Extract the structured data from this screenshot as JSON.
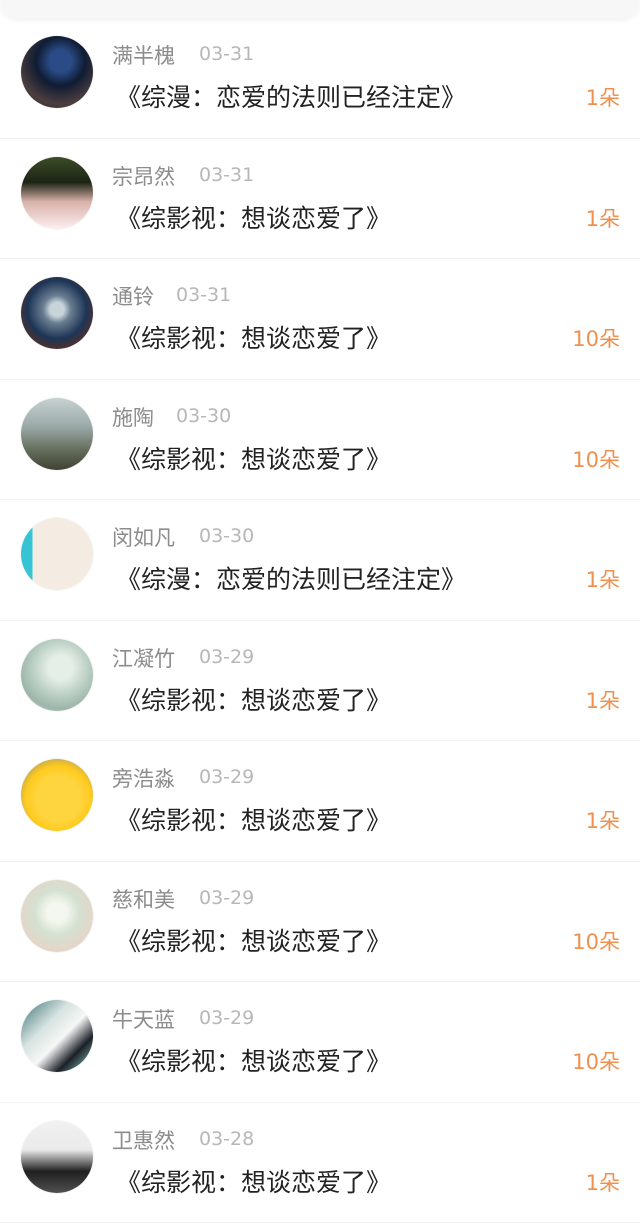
{
  "rows": [
    {
      "name": "满半槐",
      "date": "03-31",
      "title": "《综漫：恋爱的法则已经注定》",
      "count": "1朵",
      "avatar": "avatar-1"
    },
    {
      "name": "宗昂然",
      "date": "03-31",
      "title": "《综影视：想谈恋爱了》",
      "count": "1朵",
      "avatar": "avatar-2"
    },
    {
      "name": "通铃",
      "date": "03-31",
      "title": "《综影视：想谈恋爱了》",
      "count": "10朵",
      "avatar": "avatar-3"
    },
    {
      "name": "施陶",
      "date": "03-30",
      "title": "《综影视：想谈恋爱了》",
      "count": "10朵",
      "avatar": "avatar-4"
    },
    {
      "name": "闵如凡",
      "date": "03-30",
      "title": "《综漫：恋爱的法则已经注定》",
      "count": "1朵",
      "avatar": "avatar-5"
    },
    {
      "name": "江凝竹",
      "date": "03-29",
      "title": "《综影视：想谈恋爱了》",
      "count": "1朵",
      "avatar": "avatar-6"
    },
    {
      "name": "旁浩淼",
      "date": "03-29",
      "title": "《综影视：想谈恋爱了》",
      "count": "1朵",
      "avatar": "avatar-7"
    },
    {
      "name": "慈和美",
      "date": "03-29",
      "title": "《综影视：想谈恋爱了》",
      "count": "10朵",
      "avatar": "avatar-8"
    },
    {
      "name": "牛天蓝",
      "date": "03-29",
      "title": "《综影视：想谈恋爱了》",
      "count": "10朵",
      "avatar": "avatar-9"
    },
    {
      "name": "卫惠然",
      "date": "03-28",
      "title": "《综影视：想谈恋爱了》",
      "count": "1朵",
      "avatar": "avatar-10"
    }
  ]
}
